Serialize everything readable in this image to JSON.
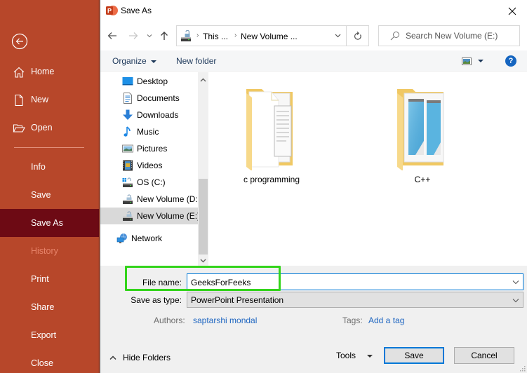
{
  "backstage": {
    "back_icon": "back-arrow-circle-icon",
    "items": [
      {
        "label": "Home",
        "icon": "home-icon",
        "state": "normal"
      },
      {
        "label": "New",
        "icon": "new-document-icon",
        "state": "normal"
      },
      {
        "label": "Open",
        "icon": "open-folder-icon",
        "state": "normal"
      },
      {
        "label": "Info",
        "state": "normal"
      },
      {
        "label": "Save",
        "state": "normal"
      },
      {
        "label": "Save As",
        "state": "active"
      },
      {
        "label": "History",
        "state": "disabled"
      },
      {
        "label": "Print",
        "state": "normal"
      },
      {
        "label": "Share",
        "state": "normal"
      },
      {
        "label": "Export",
        "state": "normal"
      },
      {
        "label": "Close",
        "state": "normal"
      }
    ],
    "colors": {
      "background": "#b7472a",
      "active": "#6d0a14",
      "disabled_text": "#e7836a"
    }
  },
  "dialog": {
    "title": "Save As",
    "app_icon": "powerpoint-icon",
    "address": {
      "crumbs": [
        "This ...",
        "New Volume ..."
      ],
      "drive_icon": "drive-icon"
    },
    "search": {
      "placeholder": "Search New Volume (E:)"
    },
    "toolbar": {
      "organize_label": "Organize",
      "new_folder_label": "New folder",
      "help_label": "?"
    },
    "nav_pane": {
      "items": [
        {
          "label": "Desktop",
          "icon": "desktop-icon"
        },
        {
          "label": "Documents",
          "icon": "documents-icon"
        },
        {
          "label": "Downloads",
          "icon": "downloads-icon"
        },
        {
          "label": "Music",
          "icon": "music-icon"
        },
        {
          "label": "Pictures",
          "icon": "pictures-icon"
        },
        {
          "label": "Videos",
          "icon": "videos-icon"
        },
        {
          "label": "OS (C:)",
          "icon": "os-drive-icon"
        },
        {
          "label": "New Volume (D:)",
          "icon": "drive-icon"
        },
        {
          "label": "New Volume (E:)",
          "icon": "drive-icon",
          "selected": true
        },
        {
          "label": "Network",
          "icon": "network-icon"
        }
      ]
    },
    "files": [
      {
        "name": "c programming",
        "type": "folder"
      },
      {
        "name": "C++",
        "type": "folder"
      }
    ],
    "form": {
      "file_name_label": "File name:",
      "file_name_value": "GeeksForFeeks",
      "save_type_label": "Save as type:",
      "save_type_value": "PowerPoint Presentation",
      "authors_label": "Authors:",
      "authors_value": "saptarshi mondal",
      "tags_label": "Tags:",
      "tags_value": "Add a tag"
    },
    "footer": {
      "hide_folders_label": "Hide Folders",
      "tools_label": "Tools",
      "save_label": "Save",
      "cancel_label": "Cancel"
    },
    "highlight_color": "#33d41b"
  }
}
